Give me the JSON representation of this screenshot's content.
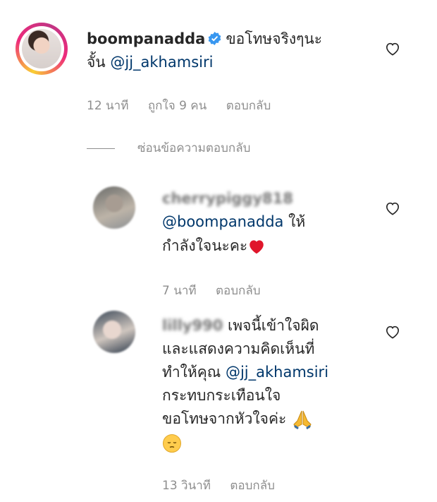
{
  "comment": {
    "username": "boompanadda",
    "text": "ขอโทษจริงๆนะ",
    "text_line2_prefix": "จั้น",
    "mention": "@jj_akhamsiri",
    "time": "12 นาที",
    "likes": "ถูกใจ 9 คน",
    "reply": "ตอบกลับ"
  },
  "hide_replies": "ซ่อนข้อความตอบกลับ",
  "replies": [
    {
      "username": "cherrypiggy818",
      "mention": "@boompanadda",
      "text_after_mention": "ให้",
      "text_line2": "กำลังใจนะคะ",
      "emoji": "heart",
      "time": "7 นาที",
      "reply": "ตอบกลับ"
    },
    {
      "username": "lilly990",
      "line1": "เพจนี้เข้าใจผิด",
      "line2": "และแสดงความคิดเห็นที่",
      "line3_prefix": "ทำให้คุณ",
      "line3_mention": "@jj_akhamsiri",
      "line4": "กระทบกระเทือนใจ",
      "line5": "ขอโทษจากหัวใจค่ะ",
      "emoji1": "folded-hands",
      "emoji2": "pensive-face",
      "time": "13 วินาที",
      "reply": "ตอบกลับ"
    }
  ],
  "colors": {
    "link": "#00376b",
    "meta": "#8e8e8e",
    "text": "#262626",
    "verified": "#3897f0",
    "heart_red": "#e0162b"
  }
}
